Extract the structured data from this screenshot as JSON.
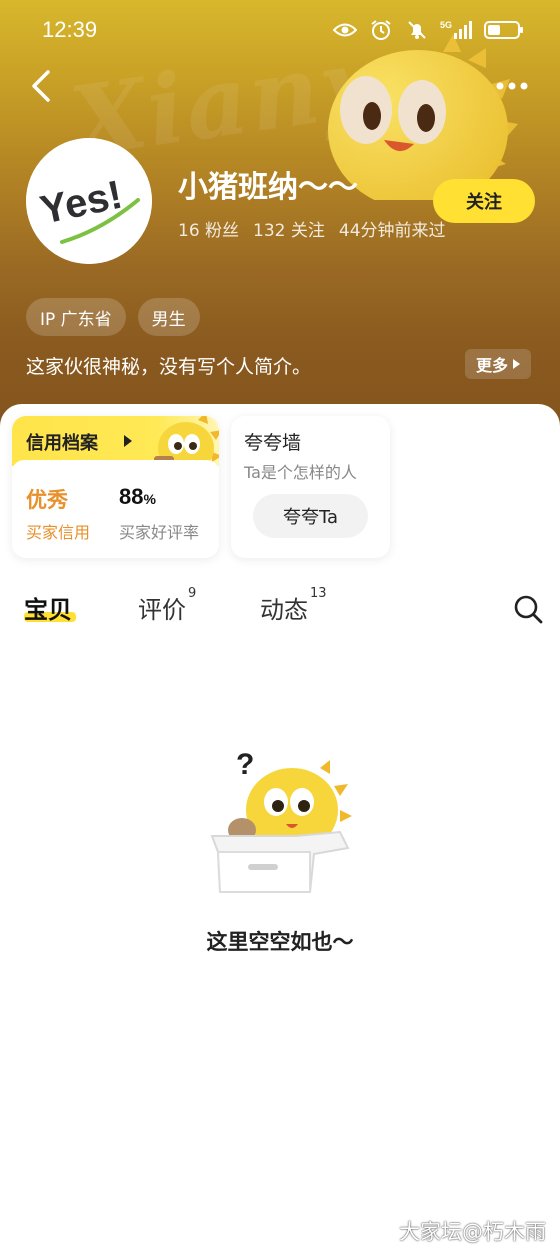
{
  "status_bar": {
    "time": "12:39",
    "network": "5G"
  },
  "header": {
    "watermark_text": "Xianyu"
  },
  "profile": {
    "avatar_text": "Yes!",
    "name": "小猪班纳～～",
    "fans": "16 粉丝",
    "following": "132 关注",
    "last_seen": "44分钟前来过",
    "follow_label": "关注",
    "tags": [
      "IP 广东省",
      "男生"
    ],
    "bio": "这家伙很神秘，没有写个人简介。",
    "more_label": "更多"
  },
  "credit": {
    "title": "信用档案",
    "level": "优秀",
    "level_label": "买家信用",
    "rate": "88",
    "rate_unit": "%",
    "rate_label": "买家好评率"
  },
  "praise": {
    "title": "夸夸墙",
    "subtitle": "Ta是个怎样的人",
    "button": "夸夸Ta"
  },
  "tabs": [
    {
      "label": "宝贝",
      "count": "",
      "active": true
    },
    {
      "label": "评价",
      "count": "9",
      "active": false
    },
    {
      "label": "动态",
      "count": "13",
      "active": false
    }
  ],
  "empty": {
    "text": "这里空空如也～"
  },
  "watermark": "大家坛@朽木雨",
  "colors": {
    "accent": "#ffe033",
    "orange": "#e8902a",
    "header_top": "#d8b72c",
    "header_bottom": "#83541e"
  }
}
